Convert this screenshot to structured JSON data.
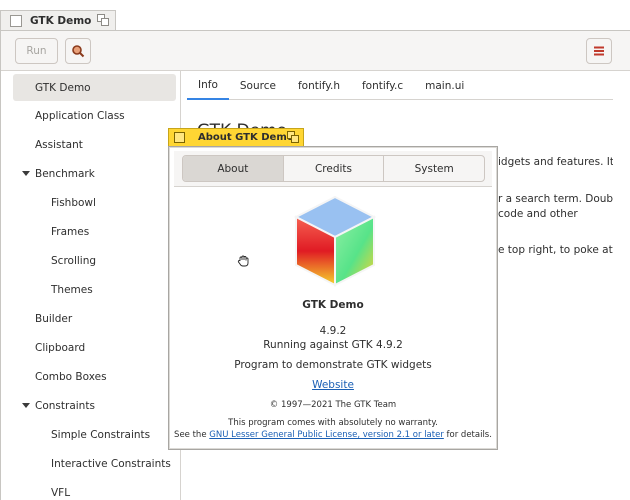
{
  "window": {
    "title": "GTK Demo"
  },
  "headerbar": {
    "run_label": "Run",
    "search_icon": "search-icon",
    "menu_icon": "hamburger-menu-icon"
  },
  "sidebar": {
    "items": [
      {
        "label": "GTK Demo",
        "selected": true
      },
      {
        "label": "Application Class"
      },
      {
        "label": "Assistant"
      },
      {
        "label": "Benchmark",
        "expanded": true
      },
      {
        "label": "Fishbowl",
        "child": true
      },
      {
        "label": "Frames",
        "child": true
      },
      {
        "label": "Scrolling",
        "child": true
      },
      {
        "label": "Themes",
        "child": true
      },
      {
        "label": "Builder"
      },
      {
        "label": "Clipboard"
      },
      {
        "label": "Combo Boxes"
      },
      {
        "label": "Constraints",
        "expanded": true
      },
      {
        "label": "Simple Constraints",
        "child": true
      },
      {
        "label": "Interactive Constraints",
        "child": true
      },
      {
        "label": "VFL",
        "child": true
      }
    ]
  },
  "tabs": [
    {
      "label": "Info",
      "active": true
    },
    {
      "label": "Source"
    },
    {
      "label": "fontify.h"
    },
    {
      "label": "fontify.c"
    },
    {
      "label": "main.ui"
    }
  ],
  "content": {
    "heading": "GTK Demo",
    "para1": "idgets and features. It",
    "para2a": "r a search term. Double-",
    "para2b": "code and other",
    "para3": "e top right, to poke at"
  },
  "about": {
    "title": "About GTK Demo",
    "tabs": [
      "About",
      "Credits",
      "System"
    ],
    "active_tab": "About",
    "app_name": "GTK Demo",
    "version": "4.9.2",
    "running": "Running against GTK 4.9.2",
    "description": "Program to demonstrate GTK widgets",
    "website": "Website",
    "copyright": "© 1997—2021 The GTK Team",
    "warranty": "This program comes with absolutely no warranty.",
    "license_prefix": "See the ",
    "license_link": "GNU Lesser General Public License, version 2.1 or later",
    "license_suffix": " for details."
  },
  "colors": {
    "accent": "#3584e4",
    "link": "#1a5fb4",
    "dialog_title_bg": "#ffd633"
  }
}
